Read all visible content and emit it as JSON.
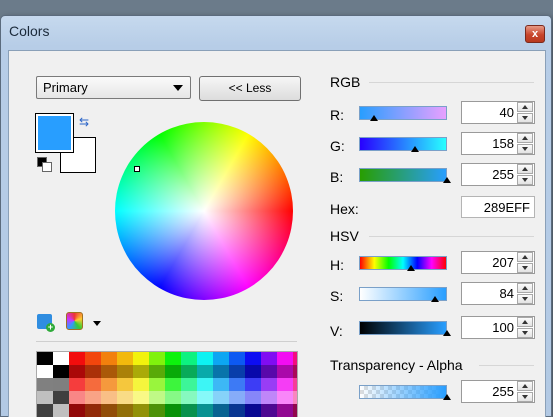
{
  "window": {
    "title": "Colors",
    "close_glyph": "x"
  },
  "left": {
    "palette_select": "Primary",
    "toggle_button": "<< Less",
    "primary_color": "#289EFF",
    "secondary_color": "#FFFFFF",
    "swap_icon": "swap-arrows-icon",
    "reset_icon": "reset-colors-icon",
    "add_icon": "add-color-icon",
    "palette_menu_icon": "palette-icon"
  },
  "rgb": {
    "title": "RGB",
    "r_label": "R:",
    "r_value": "40",
    "g_label": "G:",
    "g_value": "158",
    "b_label": "B:",
    "b_value": "255",
    "hex_label": "Hex:",
    "hex_value": "289EFF"
  },
  "hsv": {
    "title": "HSV",
    "h_label": "H:",
    "h_value": "207",
    "s_label": "S:",
    "s_value": "84",
    "v_label": "V:",
    "v_value": "100"
  },
  "alpha": {
    "title": "Transparency - Alpha",
    "value": "255"
  }
}
